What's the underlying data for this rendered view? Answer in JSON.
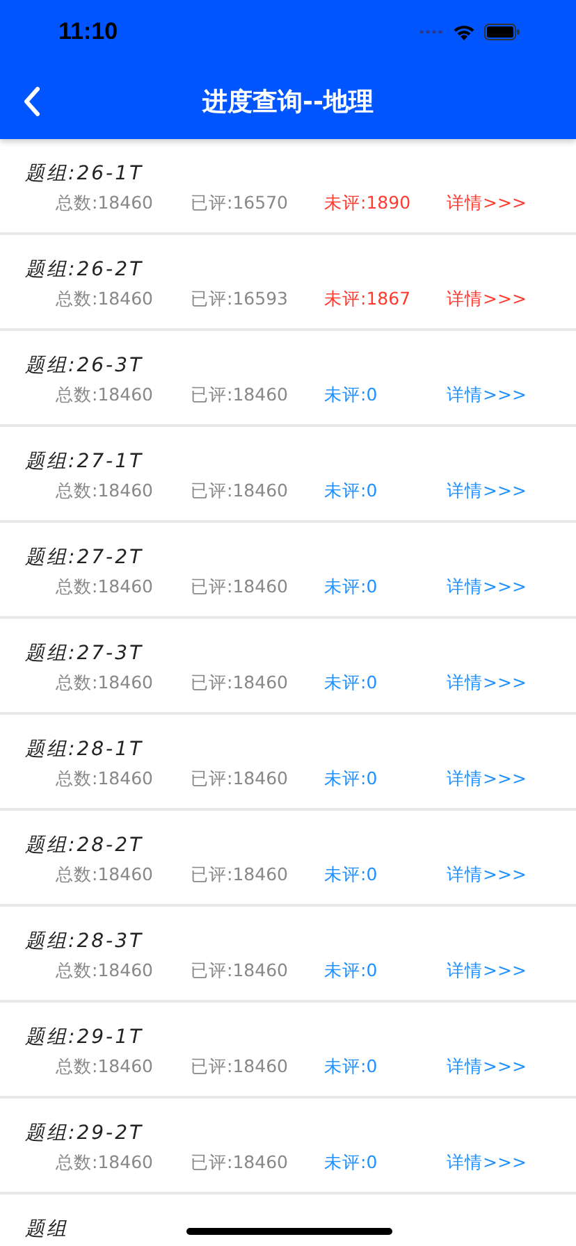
{
  "status_bar": {
    "time": "11:10"
  },
  "nav": {
    "title": "进度查询--地理"
  },
  "groups": [
    {
      "title": "题组:26-1T",
      "total": "总数:18460",
      "reviewed": "已评:16570",
      "pending": "未评:1890",
      "detail": "详情>>>",
      "color": "#ff3b30"
    },
    {
      "title": "题组:26-2T",
      "total": "总数:18460",
      "reviewed": "已评:16593",
      "pending": "未评:1867",
      "detail": "详情>>>",
      "color": "#ff3b30"
    },
    {
      "title": "题组:26-3T",
      "total": "总数:18460",
      "reviewed": "已评:18460",
      "pending": "未评:0",
      "detail": "详情>>>",
      "color": "#1e90ff"
    },
    {
      "title": "题组:27-1T",
      "total": "总数:18460",
      "reviewed": "已评:18460",
      "pending": "未评:0",
      "detail": "详情>>>",
      "color": "#1e90ff"
    },
    {
      "title": "题组:27-2T",
      "total": "总数:18460",
      "reviewed": "已评:18460",
      "pending": "未评:0",
      "detail": "详情>>>",
      "color": "#1e90ff"
    },
    {
      "title": "题组:27-3T",
      "total": "总数:18460",
      "reviewed": "已评:18460",
      "pending": "未评:0",
      "detail": "详情>>>",
      "color": "#1e90ff"
    },
    {
      "title": "题组:28-1T",
      "total": "总数:18460",
      "reviewed": "已评:18460",
      "pending": "未评:0",
      "detail": "详情>>>",
      "color": "#1e90ff"
    },
    {
      "title": "题组:28-2T",
      "total": "总数:18460",
      "reviewed": "已评:18460",
      "pending": "未评:0",
      "detail": "详情>>>",
      "color": "#1e90ff"
    },
    {
      "title": "题组:28-3T",
      "total": "总数:18460",
      "reviewed": "已评:18460",
      "pending": "未评:0",
      "detail": "详情>>>",
      "color": "#1e90ff"
    },
    {
      "title": "题组:29-1T",
      "total": "总数:18460",
      "reviewed": "已评:18460",
      "pending": "未评:0",
      "detail": "详情>>>",
      "color": "#1e90ff"
    },
    {
      "title": "题组:29-2T",
      "total": "总数:18460",
      "reviewed": "已评:18460",
      "pending": "未评:0",
      "detail": "详情>>>",
      "color": "#1e90ff"
    },
    {
      "title": "题组"
    }
  ]
}
